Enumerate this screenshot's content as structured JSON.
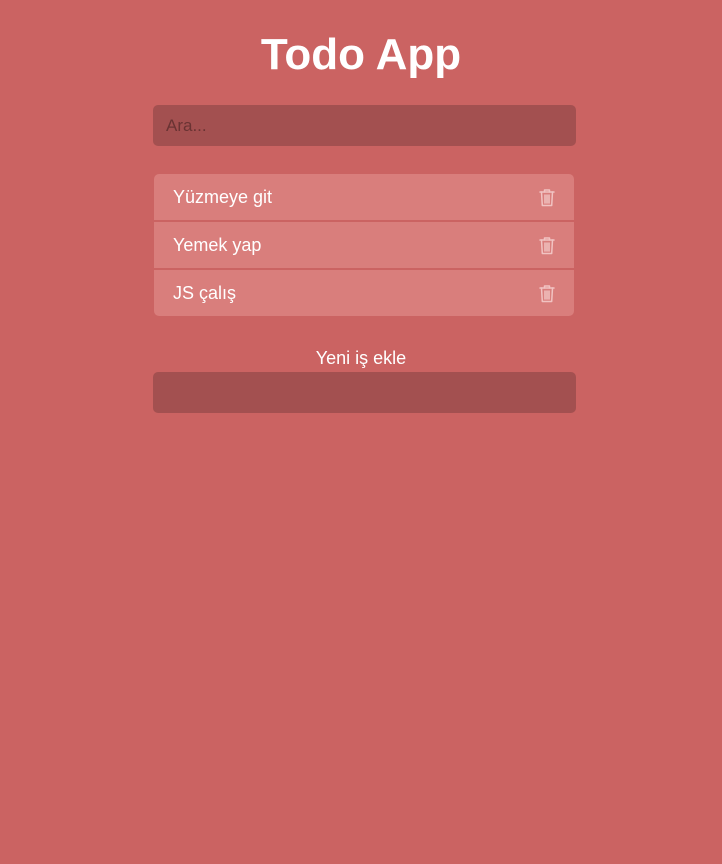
{
  "header": {
    "title": "Todo App"
  },
  "search": {
    "placeholder": "Ara...",
    "value": ""
  },
  "todos": [
    {
      "text": "Yüzmeye git",
      "icon": "trash-icon"
    },
    {
      "text": "Yemek yap",
      "icon": "trash-icon"
    },
    {
      "text": "JS çalış",
      "icon": "trash-icon"
    }
  ],
  "add_form": {
    "label": "Yeni iş ekle",
    "value": ""
  },
  "colors": {
    "background": "#cb6362",
    "input_bg": "#a35050",
    "item_bg": "#d97e7c",
    "text": "#ffffff",
    "icon": "#f1c3c2"
  }
}
